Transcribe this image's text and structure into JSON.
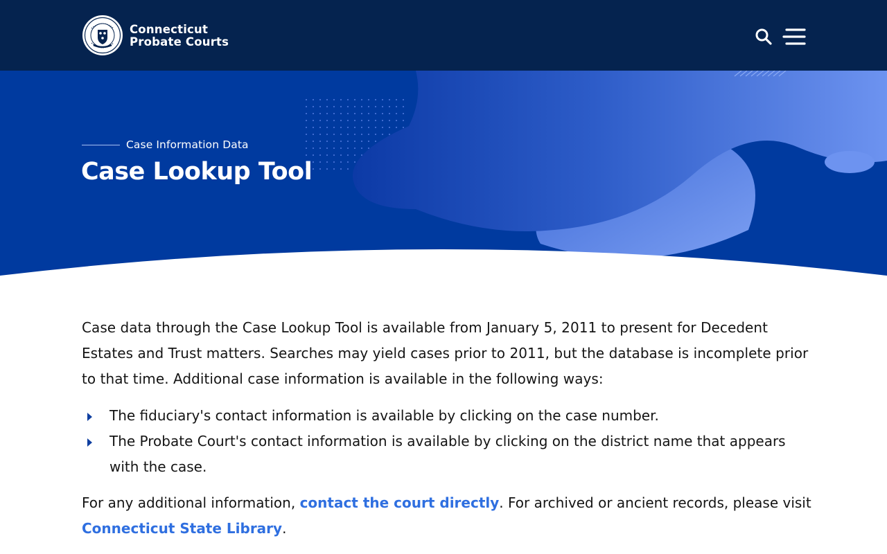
{
  "header": {
    "brand_line1": "Connecticut",
    "brand_line2": "Probate Courts",
    "logo_icon": "ct-probate-seal-icon",
    "search_icon": "search-icon",
    "menu_icon": "hamburger-menu-icon"
  },
  "hero": {
    "eyebrow": "Case Information Data",
    "title": "Case Lookup Tool"
  },
  "content": {
    "intro": "Case data through the Case Lookup Tool is available from January 5, 2011 to present for Decedent Estates and Trust matters. Searches may yield cases prior to 2011, but the database is incomplete prior to that time. Additional case information is available in the following ways:",
    "bullets": [
      "The fiduciary's contact information is available by clicking on the case number.",
      "The Probate Court's contact information is available by clicking on the district name that appears with the case."
    ],
    "closing_prefix": "For any additional information, ",
    "link_contact": "contact the court directly",
    "closing_middle": ".  For archived or ancient records, please visit ",
    "link_library": "Connecticut State Library",
    "closing_suffix": "."
  },
  "colors": {
    "header_bg": "#05234f",
    "hero_bg": "#003a9f",
    "link": "#2f6fe0",
    "bullet": "#0f3fa0"
  }
}
